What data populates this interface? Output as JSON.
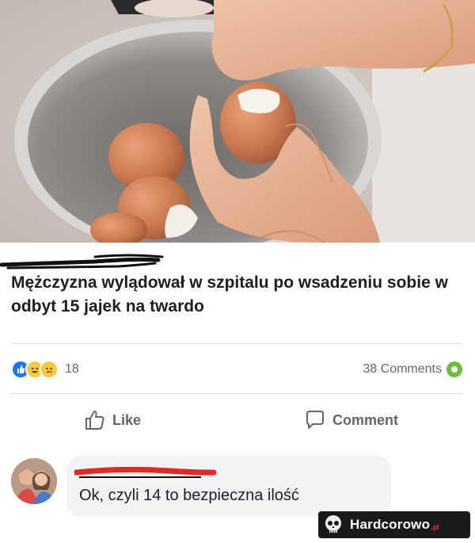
{
  "post": {
    "headline": "Mężczyzna wylądował w szpitalu po wsadzeniu sobie w odbyt 15 jajek na twardo",
    "reactions": {
      "icons": [
        "like-icon",
        "haha-icon",
        "sad-icon"
      ],
      "count": "18"
    },
    "comments_count": "38 Comments",
    "actions": {
      "like_label": "Like",
      "comment_label": "Comment"
    }
  },
  "comment": {
    "text": "Ok, czyli 14 to bezpieczna ilość"
  },
  "watermark": {
    "name": "Hardcorowo",
    "suffix": ".pl"
  },
  "colors": {
    "facebook_blue": "#1877f2",
    "reaction_yellow": "#f7c844",
    "comments_green": "#6bbf3a",
    "redaction_red": "#e02a2a",
    "redaction_black": "#111111"
  }
}
